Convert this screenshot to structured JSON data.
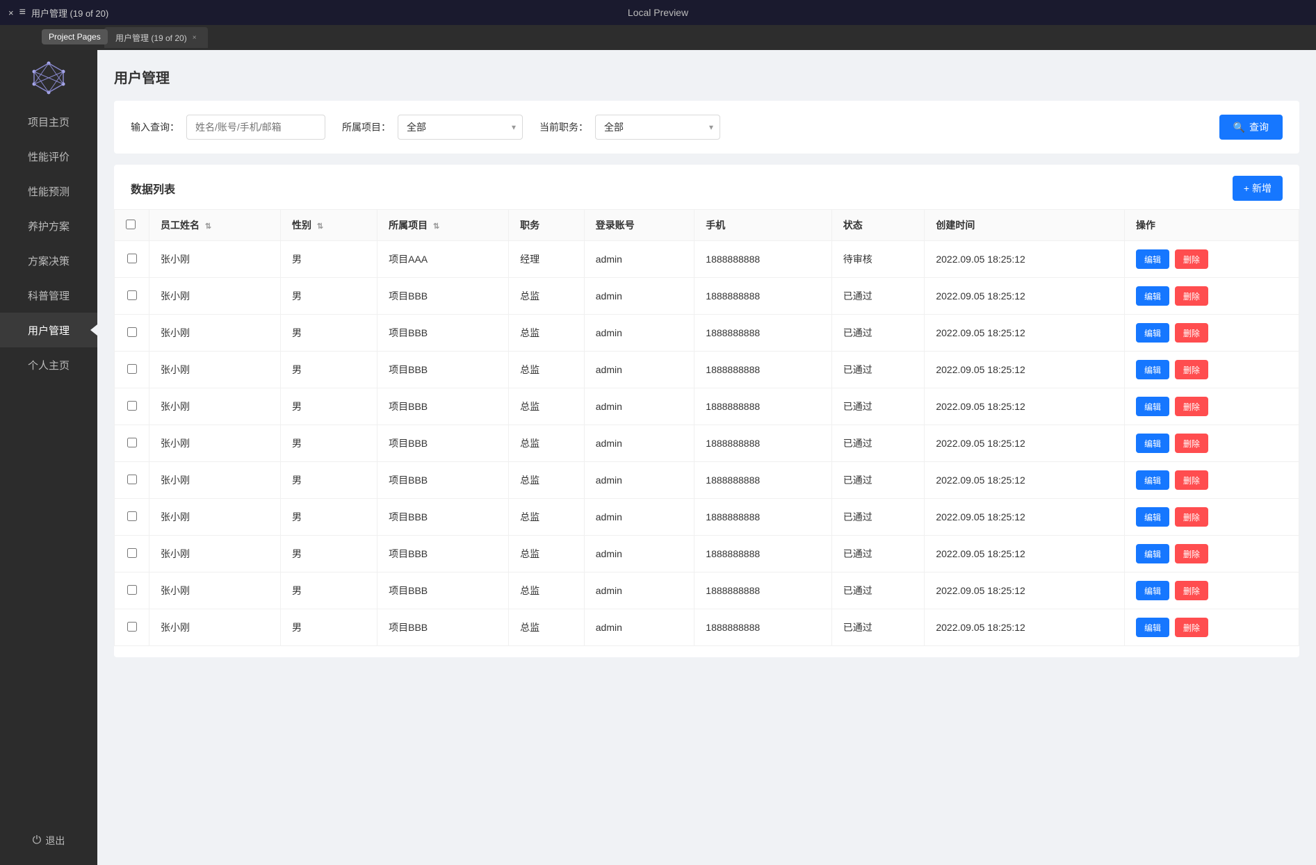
{
  "app": {
    "window_title": "用户管理  (19 of 20)",
    "preview_label": "Local Preview",
    "close_icon": "×",
    "menu_icon": "≡"
  },
  "tooltip": {
    "label": "Project Pages"
  },
  "tab": {
    "label": "用户管理  (19 of 20)",
    "close": "×"
  },
  "sidebar": {
    "logo_alt": "graph-logo",
    "items": [
      {
        "id": "home",
        "label": "项目主页",
        "active": false
      },
      {
        "id": "perf-eval",
        "label": "性能评价",
        "active": false
      },
      {
        "id": "perf-predict",
        "label": "性能预测",
        "active": false
      },
      {
        "id": "maintain",
        "label": "养护方案",
        "active": false
      },
      {
        "id": "decision",
        "label": "方案决策",
        "active": false
      },
      {
        "id": "sci-mgmt",
        "label": "科普管理",
        "active": false
      },
      {
        "id": "user-mgmt",
        "label": "用户管理",
        "active": true
      },
      {
        "id": "personal",
        "label": "个人主页",
        "active": false
      }
    ],
    "logout_label": "退出"
  },
  "page": {
    "title": "用户管理"
  },
  "search": {
    "query_label": "输入查询：",
    "query_placeholder": "姓名/账号/手机/邮箱",
    "project_label": "所属项目：",
    "project_default": "全部",
    "position_label": "当前职务：",
    "position_default": "全部",
    "search_btn_label": "查询",
    "search_icon": "🔍"
  },
  "table": {
    "section_title": "数据列表",
    "add_btn_label": "+ 新增",
    "columns": [
      {
        "id": "checkbox",
        "label": ""
      },
      {
        "id": "name",
        "label": "员工姓名",
        "sortable": true
      },
      {
        "id": "gender",
        "label": "性别",
        "sortable": true
      },
      {
        "id": "project",
        "label": "所属项目",
        "sortable": true
      },
      {
        "id": "position",
        "label": "职务"
      },
      {
        "id": "account",
        "label": "登录账号"
      },
      {
        "id": "phone",
        "label": "手机"
      },
      {
        "id": "status",
        "label": "状态"
      },
      {
        "id": "created",
        "label": "创建时间"
      },
      {
        "id": "actions",
        "label": "操作"
      }
    ],
    "rows": [
      {
        "name": "张小刚",
        "gender": "男",
        "project": "项目AAA",
        "position": "经理",
        "account": "admin",
        "phone": "1888888888",
        "status": "待审核",
        "status_type": "pending",
        "created": "2022.09.05 18:25:12"
      },
      {
        "name": "张小刚",
        "gender": "男",
        "project": "项目BBB",
        "position": "总监",
        "account": "admin",
        "phone": "1888888888",
        "status": "已通过",
        "status_type": "passed",
        "created": "2022.09.05 18:25:12"
      },
      {
        "name": "张小刚",
        "gender": "男",
        "project": "项目BBB",
        "position": "总监",
        "account": "admin",
        "phone": "1888888888",
        "status": "已通过",
        "status_type": "passed",
        "created": "2022.09.05 18:25:12"
      },
      {
        "name": "张小刚",
        "gender": "男",
        "project": "项目BBB",
        "position": "总监",
        "account": "admin",
        "phone": "1888888888",
        "status": "已通过",
        "status_type": "passed",
        "created": "2022.09.05 18:25:12"
      },
      {
        "name": "张小刚",
        "gender": "男",
        "project": "项目BBB",
        "position": "总监",
        "account": "admin",
        "phone": "1888888888",
        "status": "已通过",
        "status_type": "passed",
        "created": "2022.09.05 18:25:12"
      },
      {
        "name": "张小刚",
        "gender": "男",
        "project": "项目BBB",
        "position": "总监",
        "account": "admin",
        "phone": "1888888888",
        "status": "已通过",
        "status_type": "passed",
        "created": "2022.09.05 18:25:12"
      },
      {
        "name": "张小刚",
        "gender": "男",
        "project": "项目BBB",
        "position": "总监",
        "account": "admin",
        "phone": "1888888888",
        "status": "已通过",
        "status_type": "passed",
        "created": "2022.09.05 18:25:12"
      },
      {
        "name": "张小刚",
        "gender": "男",
        "project": "项目BBB",
        "position": "总监",
        "account": "admin",
        "phone": "1888888888",
        "status": "已通过",
        "status_type": "passed",
        "created": "2022.09.05 18:25:12"
      },
      {
        "name": "张小刚",
        "gender": "男",
        "project": "项目BBB",
        "position": "总监",
        "account": "admin",
        "phone": "1888888888",
        "status": "已通过",
        "status_type": "passed",
        "created": "2022.09.05 18:25:12"
      },
      {
        "name": "张小刚",
        "gender": "男",
        "project": "项目BBB",
        "position": "总监",
        "account": "admin",
        "phone": "1888888888",
        "status": "已通过",
        "status_type": "passed",
        "created": "2022.09.05 18:25:12"
      },
      {
        "name": "张小刚",
        "gender": "男",
        "project": "项目BBB",
        "position": "总监",
        "account": "admin",
        "phone": "1888888888",
        "status": "已通过",
        "status_type": "passed",
        "created": "2022.09.05 18:25:12"
      }
    ],
    "edit_btn_label": "编辑",
    "delete_btn_label": "删除"
  }
}
